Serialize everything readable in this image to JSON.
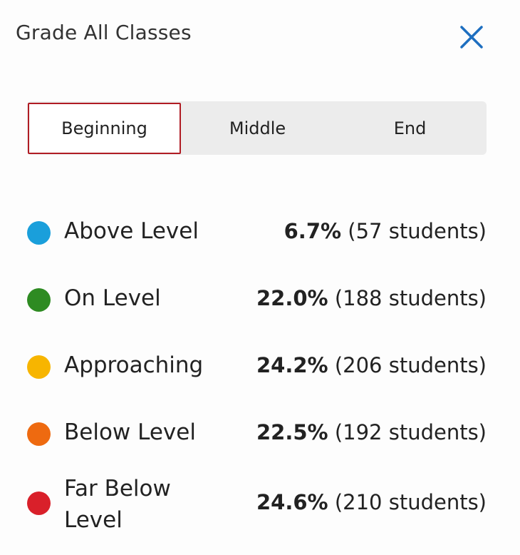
{
  "header": {
    "title": "Grade All Classes"
  },
  "tabs": [
    {
      "label": "Beginning",
      "selected": true
    },
    {
      "label": "Middle",
      "selected": false
    },
    {
      "label": "End",
      "selected": false
    }
  ],
  "colors": {
    "selected_tab_border": "#b01c24",
    "close_icon": "#1e6fc0"
  },
  "levels": [
    {
      "label": "Above Level",
      "percent": "6.7%",
      "count": "(57 students)",
      "color": "#1a9fdb"
    },
    {
      "label": "On Level",
      "percent": "22.0%",
      "count": "(188 students)",
      "color": "#2e8b22"
    },
    {
      "label": "Approaching",
      "percent": "24.2%",
      "count": "(206 students)",
      "color": "#f7b500"
    },
    {
      "label": "Below Level",
      "percent": "22.5%",
      "count": "(192 students)",
      "color": "#ee6a10"
    },
    {
      "label": "Far Below Level",
      "percent": "24.6%",
      "count": "(210 students)",
      "color": "#d9202a"
    }
  ]
}
